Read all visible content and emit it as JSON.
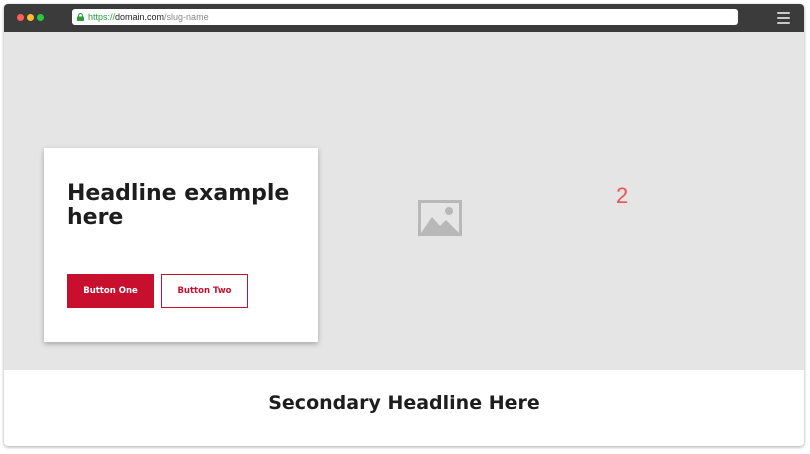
{
  "browser": {
    "url_scheme": "https://",
    "url_host": "domain.com",
    "url_path": "/slug-name",
    "lock_icon": "lock-icon",
    "menu_icon": "hamburger-menu-icon"
  },
  "hero": {
    "headline": "Headline example here",
    "button_one": "Button One",
    "button_two": "Button Two",
    "image_icon": "image-placeholder-icon",
    "marker": "2"
  },
  "secondary": {
    "headline": "Secondary Headline Here"
  },
  "colors": {
    "accent": "#c8102e",
    "marker": "#f0524f",
    "hero_background": "#e5e5e5",
    "titlebar": "#3b3b3b"
  }
}
